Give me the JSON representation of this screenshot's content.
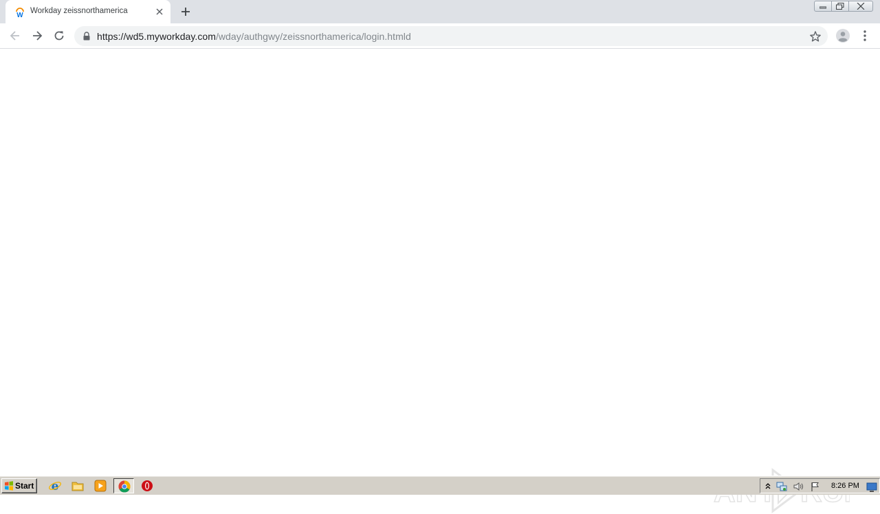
{
  "browser": {
    "tab": {
      "title": "Workday zeissnorthamerica",
      "favicon": "workday-w-icon"
    },
    "address_bar": {
      "url_scheme_host": "https://wd5.myworkday.com",
      "url_path": "/wday/authgwy/zeissnorthamerica/login.htmld"
    },
    "icons": [
      "back-arrow-icon",
      "forward-arrow-icon",
      "reload-icon",
      "lock-icon",
      "star-icon",
      "profile-icon",
      "kebab-menu-icon",
      "new-tab-icon",
      "close-tab-icon"
    ]
  },
  "watermark": {
    "text": "ANY RUN"
  },
  "taskbar": {
    "start_label": "Start",
    "pinned": [
      "internet-explorer-icon",
      "file-explorer-icon",
      "media-player-icon",
      "chrome-icon",
      "opera-icon"
    ],
    "tray_icons": [
      "show-hidden-icons-icon",
      "network-icon",
      "volume-icon",
      "action-center-flag-icon"
    ],
    "clock": "8:26 PM"
  },
  "colors": {
    "tabstrip": "#dee1e6",
    "omnibox": "#f1f3f4",
    "taskbar": "#d4d0c8",
    "workday_blue": "#0875e1",
    "workday_orange": "#f38b00"
  }
}
